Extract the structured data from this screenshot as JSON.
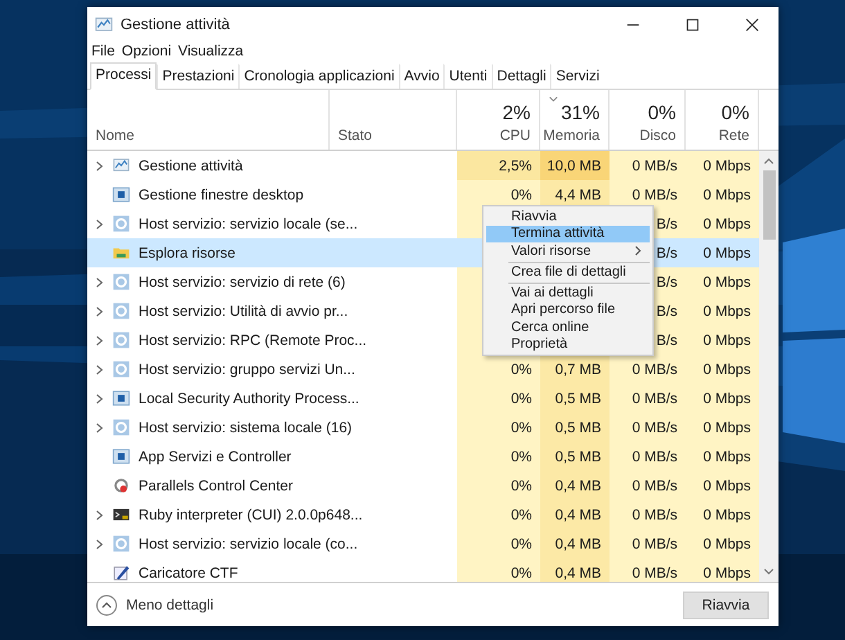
{
  "window": {
    "title": "Gestione attività"
  },
  "menu_bar": [
    "File",
    "Opzioni",
    "Visualizza"
  ],
  "tabs": [
    {
      "label": "Processi",
      "selected": true
    },
    {
      "label": "Prestazioni",
      "selected": false
    },
    {
      "label": "Cronologia applicazioni",
      "selected": false
    },
    {
      "label": "Avvio",
      "selected": false
    },
    {
      "label": "Utenti",
      "selected": false
    },
    {
      "label": "Dettagli",
      "selected": false
    },
    {
      "label": "Servizi",
      "selected": false
    }
  ],
  "columns": [
    {
      "label": "Nome",
      "sorted": false
    },
    {
      "label": "Stato",
      "sorted": false
    },
    {
      "label": "CPU",
      "percent": "2%",
      "sorted": false
    },
    {
      "label": "Memoria",
      "percent": "31%",
      "sorted": true
    },
    {
      "label": "Disco",
      "percent": "0%",
      "sorted": false
    },
    {
      "label": "Rete",
      "percent": "0%",
      "sorted": false
    }
  ],
  "rows": [
    {
      "name": "Gestione attività",
      "kind": "taskmgr",
      "expandable": true,
      "selected": false,
      "cpu": {
        "text": "2,5%",
        "hot": true
      },
      "memory": {
        "text": "10,0 MB",
        "hot": true
      },
      "disk": "0 MB/s",
      "network": "0 Mbps"
    },
    {
      "name": "Gestione finestre desktop",
      "kind": "window",
      "expandable": false,
      "selected": false,
      "cpu": {
        "text": "0%",
        "hot": false
      },
      "memory": {
        "text": "4,4 MB",
        "hot": false
      },
      "disk": "0 MB/s",
      "network": "0 Mbps"
    },
    {
      "name": "Host servizio: servizio locale (se...",
      "kind": "service",
      "expandable": true,
      "selected": false,
      "disk": "B/s",
      "network": "0 Mbps"
    },
    {
      "name": "Esplora risorse",
      "kind": "explorer",
      "expandable": false,
      "selected": true,
      "disk": "B/s",
      "network": "0 Mbps"
    },
    {
      "name": "Host servizio: servizio di rete (6)",
      "kind": "service",
      "expandable": true,
      "selected": false,
      "disk": "B/s",
      "network": "0 Mbps"
    },
    {
      "name": "Host servizio: Utilità di avvio pr...",
      "kind": "service",
      "expandable": true,
      "selected": false,
      "disk": "B/s",
      "network": "0 Mbps"
    },
    {
      "name": "Host servizio: RPC (Remote Proc...",
      "kind": "service",
      "expandable": true,
      "selected": false,
      "disk": "B/s",
      "network": "0 Mbps"
    },
    {
      "name": "Host servizio: gruppo servizi Un...",
      "kind": "service",
      "expandable": true,
      "selected": false,
      "cpu": {
        "text": "0%",
        "hot": false
      },
      "memory": {
        "text": "0,7 MB",
        "hot": false
      },
      "disk": "0 MB/s",
      "network": "0 Mbps"
    },
    {
      "name": "Local Security Authority Process...",
      "kind": "window",
      "expandable": true,
      "selected": false,
      "cpu": {
        "text": "0%",
        "hot": false
      },
      "memory": {
        "text": "0,5 MB",
        "hot": false
      },
      "disk": "0 MB/s",
      "network": "0 Mbps"
    },
    {
      "name": "Host servizio: sistema locale (16)",
      "kind": "service",
      "expandable": true,
      "selected": false,
      "cpu": {
        "text": "0%",
        "hot": false
      },
      "memory": {
        "text": "0,5 MB",
        "hot": false
      },
      "disk": "0 MB/s",
      "network": "0 Mbps"
    },
    {
      "name": "App Servizi e Controller",
      "kind": "window",
      "expandable": false,
      "selected": false,
      "cpu": {
        "text": "0%",
        "hot": false
      },
      "memory": {
        "text": "0,5 MB",
        "hot": false
      },
      "disk": "0 MB/s",
      "network": "0 Mbps"
    },
    {
      "name": "Parallels Control Center",
      "kind": "parallels",
      "expandable": false,
      "selected": false,
      "cpu": {
        "text": "0%",
        "hot": false
      },
      "memory": {
        "text": "0,4 MB",
        "hot": false
      },
      "disk": "0 MB/s",
      "network": "0 Mbps"
    },
    {
      "name": "Ruby interpreter (CUI) 2.0.0p648...",
      "kind": "console",
      "expandable": true,
      "selected": false,
      "cpu": {
        "text": "0%",
        "hot": false
      },
      "memory": {
        "text": "0,4 MB",
        "hot": false
      },
      "disk": "0 MB/s",
      "network": "0 Mbps"
    },
    {
      "name": "Host servizio: servizio locale (co...",
      "kind": "service",
      "expandable": true,
      "selected": false,
      "cpu": {
        "text": "0%",
        "hot": false
      },
      "memory": {
        "text": "0,4 MB",
        "hot": false
      },
      "disk": "0 MB/s",
      "network": "0 Mbps"
    },
    {
      "name": "Caricatore CTF",
      "kind": "pen",
      "expandable": false,
      "selected": false,
      "cpu": {
        "text": "0%",
        "hot": false
      },
      "memory": {
        "text": "0,4 MB",
        "hot": false
      },
      "disk": "0 MB/s",
      "network": "0 Mbps"
    }
  ],
  "context_menu": [
    {
      "label": "Riavvia",
      "selected": false,
      "submenu": false,
      "separator_before": false
    },
    {
      "label": "Termina attività",
      "selected": true,
      "submenu": false,
      "separator_before": false
    },
    {
      "label": "Valori risorse",
      "selected": false,
      "submenu": true,
      "separator_before": false
    },
    {
      "label": "Crea file di dettagli",
      "selected": false,
      "submenu": false,
      "separator_before": true
    },
    {
      "label": "Vai ai dettagli",
      "selected": false,
      "submenu": false,
      "separator_before": true
    },
    {
      "label": "Apri percorso file",
      "selected": false,
      "submenu": false,
      "separator_before": false
    },
    {
      "label": "Cerca online",
      "selected": false,
      "submenu": false,
      "separator_before": false
    },
    {
      "label": "Proprietà",
      "selected": false,
      "submenu": false,
      "separator_before": false
    }
  ],
  "footer": {
    "details_toggle": "Meno dettagli",
    "button": "Riavvia"
  }
}
